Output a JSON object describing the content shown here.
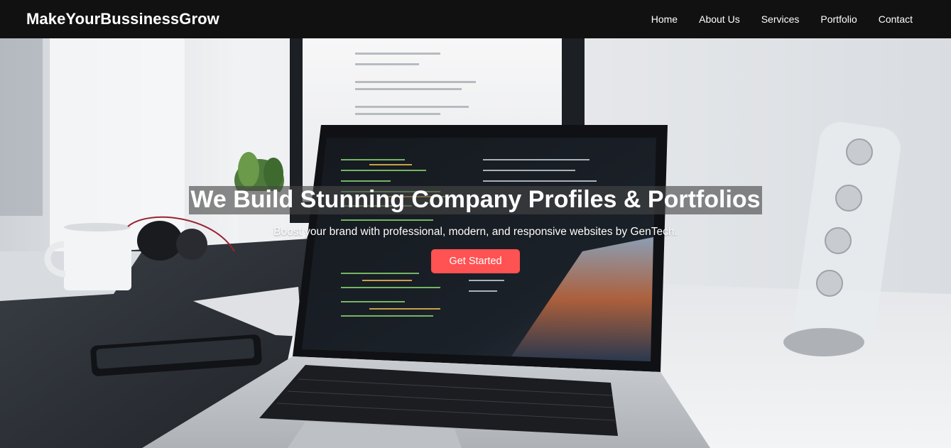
{
  "brand": {
    "name": "MakeYourBussinessGrow"
  },
  "nav": {
    "items": [
      {
        "label": "Home"
      },
      {
        "label": "About Us"
      },
      {
        "label": "Services"
      },
      {
        "label": "Portfolio"
      },
      {
        "label": "Contact"
      }
    ]
  },
  "hero": {
    "title": "We Build Stunning Company Profiles & Portfolios",
    "subtitle": "Boost your brand with professional, modern, and responsive websites by GenTech.",
    "cta_label": "Get Started"
  },
  "colors": {
    "navbar_bg": "#111111",
    "accent": "#ff5252",
    "text_light": "#ffffff"
  }
}
